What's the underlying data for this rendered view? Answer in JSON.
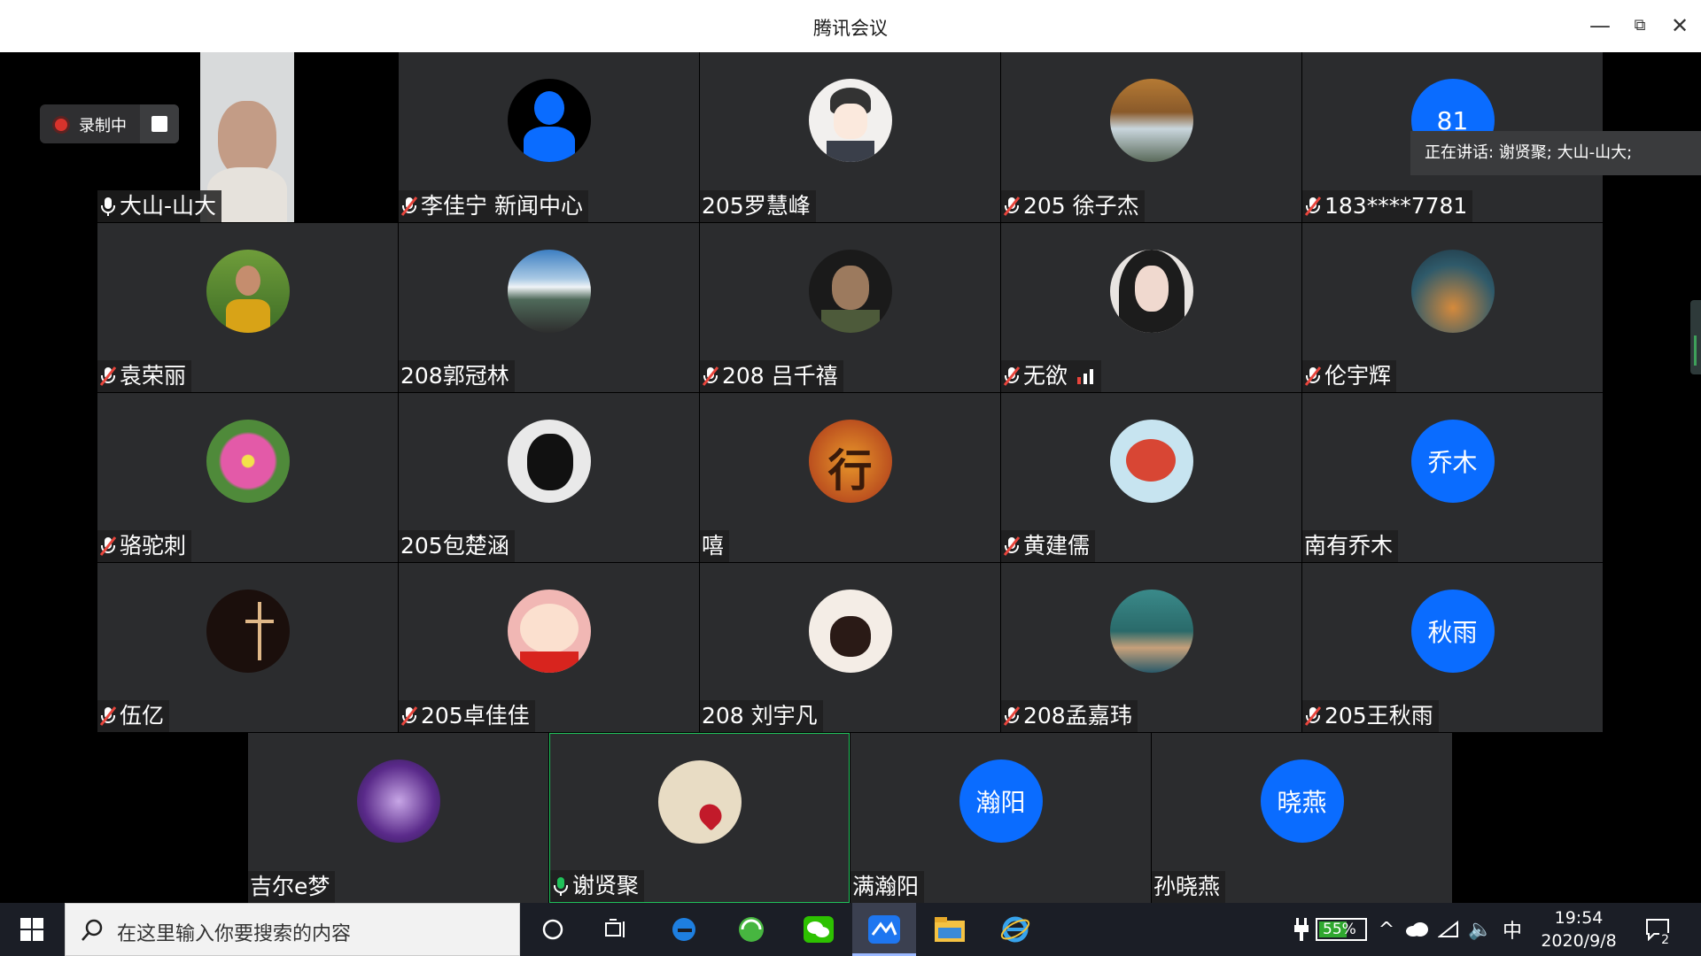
{
  "window": {
    "title": "腾讯会议",
    "minimize_icon": "minimize-icon",
    "restore_icon": "restore-icon",
    "close_icon": "close-icon"
  },
  "recording": {
    "label": "录制中"
  },
  "speaking": {
    "text": "正在讲话: 谢贤聚; 大山-山大;"
  },
  "participants": [
    {
      "name": "大山-山大",
      "mic": "on",
      "avatar": "video"
    },
    {
      "name": "李佳宁 新闻中心",
      "mic": "muted",
      "avatar": "default-user"
    },
    {
      "name": "205罗慧峰",
      "mic": "none",
      "avatar": "cartoon-man"
    },
    {
      "name": "205 徐子杰",
      "mic": "muted",
      "avatar": "waterfall"
    },
    {
      "name": "183****7781",
      "mic": "muted",
      "avatar_text": "81"
    },
    {
      "name": "袁荣丽",
      "mic": "muted",
      "avatar": "woman-photo"
    },
    {
      "name": "208郭冠林",
      "mic": "none",
      "avatar": "mountain-road"
    },
    {
      "name": "208 吕千禧",
      "mic": "muted",
      "avatar": "soldier"
    },
    {
      "name": "无欲",
      "mic": "muted",
      "avatar": "girl-portrait",
      "signal": true
    },
    {
      "name": "伦宇辉",
      "mic": "muted",
      "avatar": "rainy-painting"
    },
    {
      "name": "骆驼刺",
      "mic": "muted",
      "avatar": "pink-flower"
    },
    {
      "name": "205包楚涵",
      "mic": "none",
      "avatar": "black-cat"
    },
    {
      "name": "嘻",
      "mic": "none",
      "avatar": "xing-character"
    },
    {
      "name": "黄建儒",
      "mic": "muted",
      "avatar": "red-fish"
    },
    {
      "name": "南有乔木",
      "mic": "none",
      "avatar_text": "乔木"
    },
    {
      "name": "伍亿",
      "mic": "muted",
      "avatar": "dark-cross"
    },
    {
      "name": "205卓佳佳",
      "mic": "muted",
      "avatar": "crayon-shin"
    },
    {
      "name": "208 刘宇凡",
      "mic": "none",
      "avatar": "cartoon-cat"
    },
    {
      "name": "208孟嘉玮",
      "mic": "muted",
      "avatar": "group-photo"
    },
    {
      "name": "205王秋雨",
      "mic": "muted",
      "avatar_text": "秋雨"
    },
    {
      "name": "吉尔e梦",
      "mic": "none",
      "avatar": "anime-girl"
    },
    {
      "name": "谢贤聚",
      "mic": "speaking",
      "avatar": "happy-card"
    },
    {
      "name": "满瀚阳",
      "mic": "none",
      "avatar_text": "瀚阳"
    },
    {
      "name": "孙晓燕",
      "mic": "none",
      "avatar_text": "晓燕"
    }
  ],
  "taskbar": {
    "search_placeholder": "在这里输入你要搜索的内容",
    "battery": "55%",
    "ime": "中",
    "time": "19:54",
    "date": "2020/9/8",
    "notification_count": "2"
  }
}
